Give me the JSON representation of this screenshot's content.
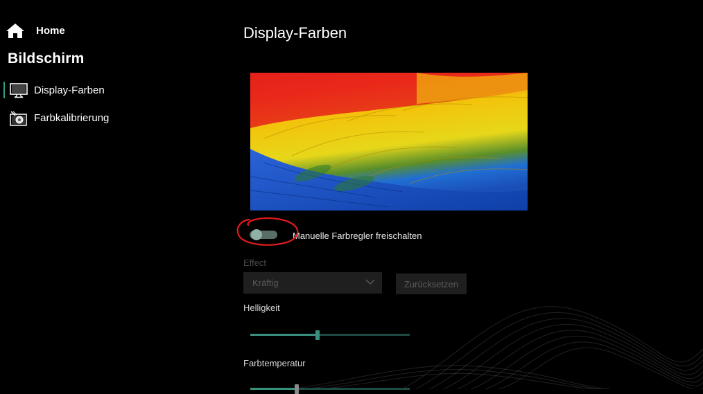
{
  "sidebar": {
    "home_label": "Home",
    "section_title": "Bildschirm",
    "items": [
      {
        "label": "Display-Farben",
        "icon": "monitor-icon",
        "selected": true
      },
      {
        "label": "Farbkalibrierung",
        "icon": "color-calibration-icon",
        "selected": false
      }
    ]
  },
  "main": {
    "title": "Display-Farben",
    "preview_image": "parrot-feathers-image",
    "toggle": {
      "label": "Manuelle Farbregler freischalten",
      "on": false
    },
    "effect": {
      "label": "Effect",
      "selected": "Kräftig"
    },
    "reset_label": "Zurücksetzen",
    "sliders": [
      {
        "label": "Helligkeit",
        "value": 0.42
      },
      {
        "label": "Farbtemperatur",
        "value": 0.29
      }
    ]
  },
  "colors": {
    "accent": "#3a8f7c",
    "annotation": "#e01b1b"
  }
}
